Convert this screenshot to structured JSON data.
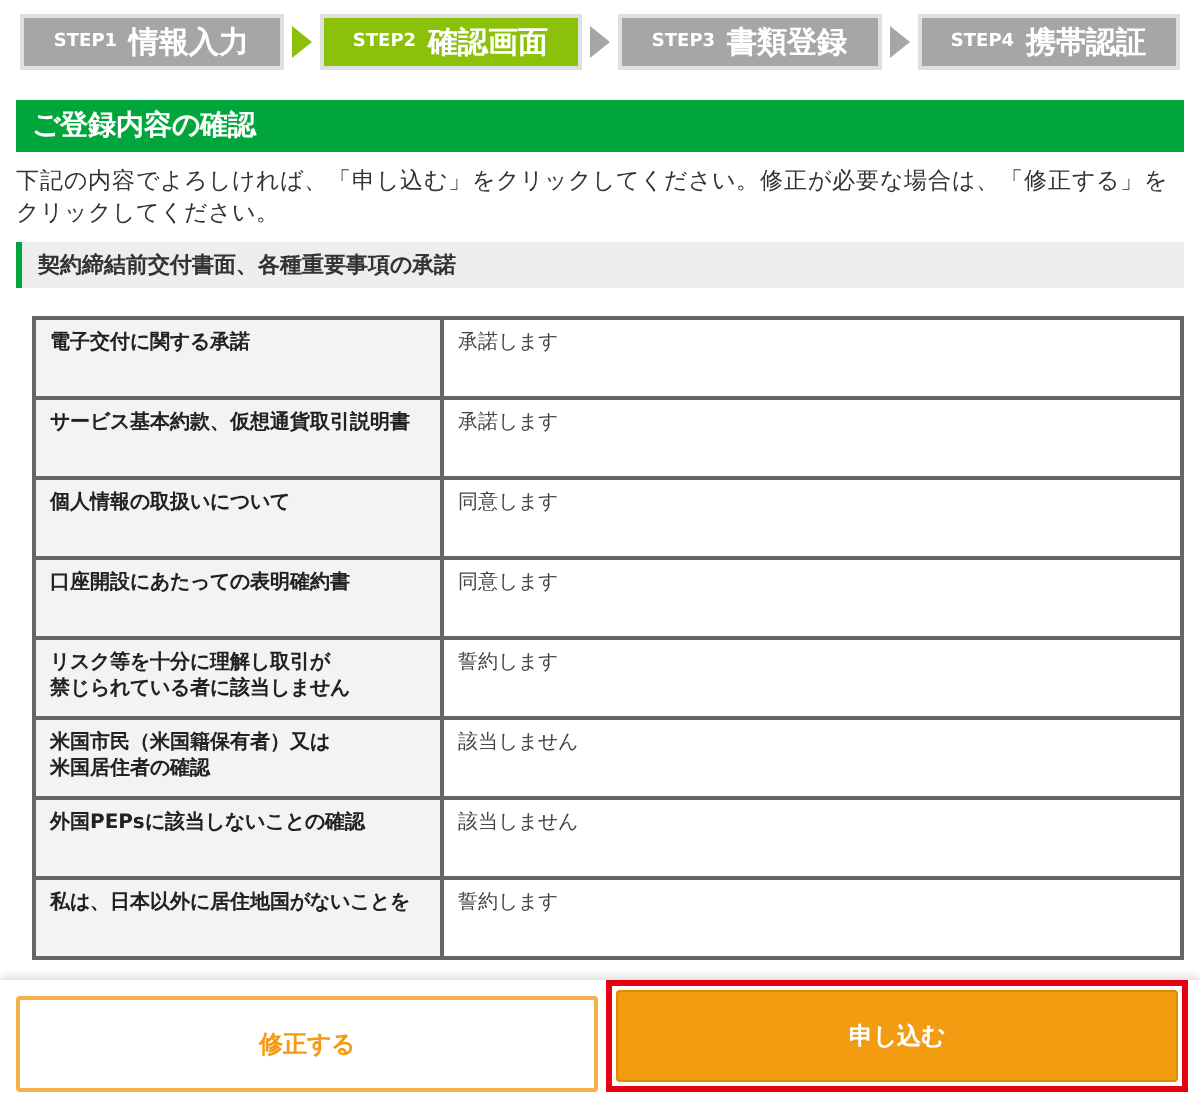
{
  "steps": [
    {
      "step": "STEP1",
      "label": "情報入力",
      "selected": false
    },
    {
      "step": "STEP2",
      "label": "確認画面",
      "selected": true
    },
    {
      "step": "STEP3",
      "label": "書類登録",
      "selected": false
    },
    {
      "step": "STEP4",
      "label": "携帯認証",
      "selected": false
    }
  ],
  "section_title": "ご登録内容の確認",
  "intro": "下記の内容でよろしければ、「申し込む」をクリックしてください。修正が必要な場合は、「修正する」をクリックしてください。",
  "subsection_title": "契約締結前交付書面、各種重要事項の承諾",
  "table": {
    "rows": [
      {
        "label": "電子交付に関する承諾",
        "value": "承諾します"
      },
      {
        "label": "サービス基本約款、仮想通貨取引説明書",
        "value": "承諾します"
      },
      {
        "label": "個人情報の取扱いについて",
        "value": "同意します"
      },
      {
        "label": "口座開設にあたっての表明確約書",
        "value": "同意します"
      },
      {
        "label_lines": [
          "リスク等を十分に理解し取引が",
          "禁じられている者に該当しません"
        ],
        "value": "誓約します"
      },
      {
        "label_lines": [
          "米国市民（米国籍保有者）又は",
          "米国居住者の確認"
        ],
        "value": "該当しません"
      },
      {
        "label": "外国PEPsに該当しないことの確認",
        "value": "該当しません"
      },
      {
        "label": "私は、日本以外に居住地国がないことを",
        "value": "誓約します"
      }
    ]
  },
  "buttons": [
    {
      "label": "修正する",
      "kind": "secondary",
      "highlighted": false
    },
    {
      "label": "申し込む",
      "kind": "primary",
      "highlighted": true
    }
  ]
}
